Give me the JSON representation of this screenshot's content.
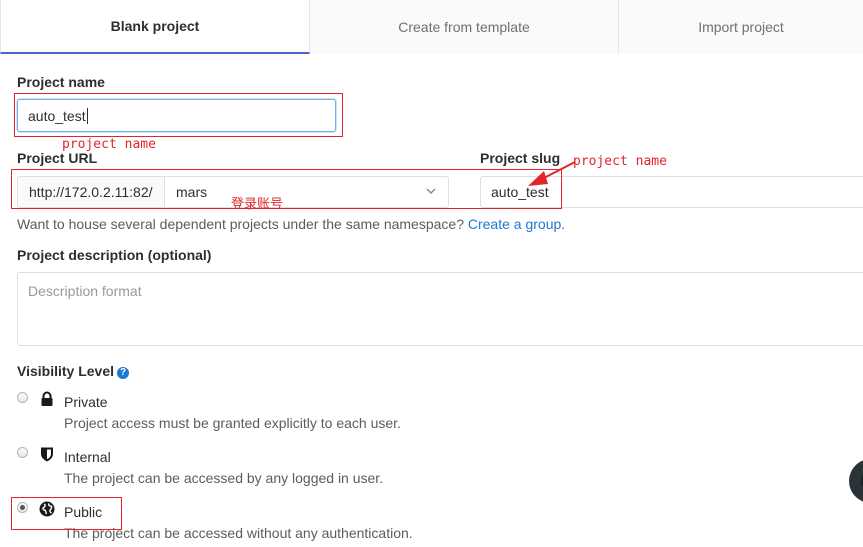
{
  "tabs": [
    {
      "label": "Blank project",
      "active": true
    },
    {
      "label": "Create from template",
      "active": false
    },
    {
      "label": "Import project",
      "active": false
    }
  ],
  "form": {
    "project_name_label": "Project name",
    "project_name_value": "auto_test",
    "project_url_label": "Project URL",
    "url_prefix": "http://172.0.2.11:82/",
    "namespace_value": "mars",
    "project_slug_label": "Project slug",
    "project_slug_value": "auto_test",
    "namespace_help": "Want to house several dependent projects under the same namespace?",
    "create_group_link": "Create a group.",
    "description_label": "Project description (optional)",
    "description_placeholder": "Description format",
    "visibility_label": "Visibility Level",
    "visibility_help_icon": "question-circle-icon",
    "visibility_options": [
      {
        "title": "Private",
        "description": "Project access must be granted explicitly to each user.",
        "icon": "lock-icon",
        "checked": false
      },
      {
        "title": "Internal",
        "description": "The project can be accessed by any logged in user.",
        "icon": "shield-icon",
        "checked": false
      },
      {
        "title": "Public",
        "description": "The project can be accessed without any authentication.",
        "icon": "globe-icon",
        "checked": true
      }
    ]
  },
  "annotations": {
    "name_note": "project name",
    "slug_note": "project name",
    "namespace_note": "登录账号"
  },
  "colors": {
    "accent": "#4a63c7",
    "link": "#1f78d1",
    "annotation_red": "#e0262b"
  }
}
